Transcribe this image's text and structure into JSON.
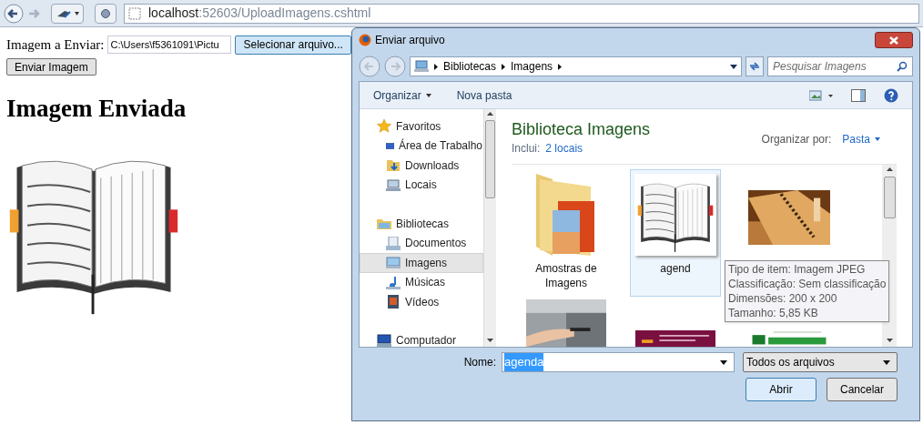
{
  "browser": {
    "url_host": "localhost",
    "url_rest": ":52603/UploadImagens.cshtml"
  },
  "page": {
    "field_label": "Imagem a Enviar:",
    "file_value": "C:\\Users\\f5361091\\Pictu",
    "choose_button": "Selecionar arquivo...",
    "submit_button": "Enviar Imagem",
    "heading": "Imagem Enviada"
  },
  "dialog": {
    "title": "Enviar arquivo",
    "breadcrumb": [
      "Bibliotecas",
      "Imagens"
    ],
    "search": {
      "placeholder": "Pesquisar Imagens"
    },
    "toolbar": [
      "Organizar",
      "Nova pasta"
    ],
    "nav": [
      {
        "label": "Favoritos",
        "kind": "star",
        "selected": false,
        "children": [
          {
            "label": "Área de Trabalho",
            "kind": "desktop",
            "selected": false
          },
          {
            "label": "Downloads",
            "kind": "download",
            "selected": false
          },
          {
            "label": "Locais",
            "kind": "places",
            "selected": false
          }
        ]
      },
      {
        "label": "Bibliotecas",
        "kind": "library",
        "selected": false,
        "children": [
          {
            "label": "Documentos",
            "kind": "docs",
            "selected": false
          },
          {
            "label": "Imagens",
            "kind": "images",
            "selected": true
          },
          {
            "label": "Músicas",
            "kind": "music",
            "selected": false
          },
          {
            "label": "Vídeos",
            "kind": "video",
            "selected": false
          }
        ]
      },
      {
        "label": "Computador",
        "kind": "computer",
        "selected": false
      }
    ],
    "library_title": "Biblioteca Imagens",
    "includes_label": "Inclui:",
    "includes_link": "2 locais",
    "arrange_label": "Organizar por:",
    "arrange_value": "Pasta",
    "items": [
      {
        "label": "Amostras de Imagens",
        "kind": "folder",
        "selected": false
      },
      {
        "label": "agend",
        "kind": "book",
        "selected": true
      },
      {
        "kind": "spiral",
        "selected": false
      },
      {
        "kind": "machine",
        "selected": false
      },
      {
        "kind": "banner",
        "selected": false
      },
      {
        "kind": "logo",
        "selected": false
      }
    ],
    "tooltip": [
      "Tipo de item: Imagem JPEG",
      "Classificação: Sem classificação",
      "Dimensões: 200 x 200",
      "Tamanho: 5,85 KB"
    ],
    "name_label": "Nome:",
    "name_value": "agenda",
    "filter": "Todos os arquivos",
    "buttons": [
      "Abrir",
      "Cancelar"
    ]
  }
}
